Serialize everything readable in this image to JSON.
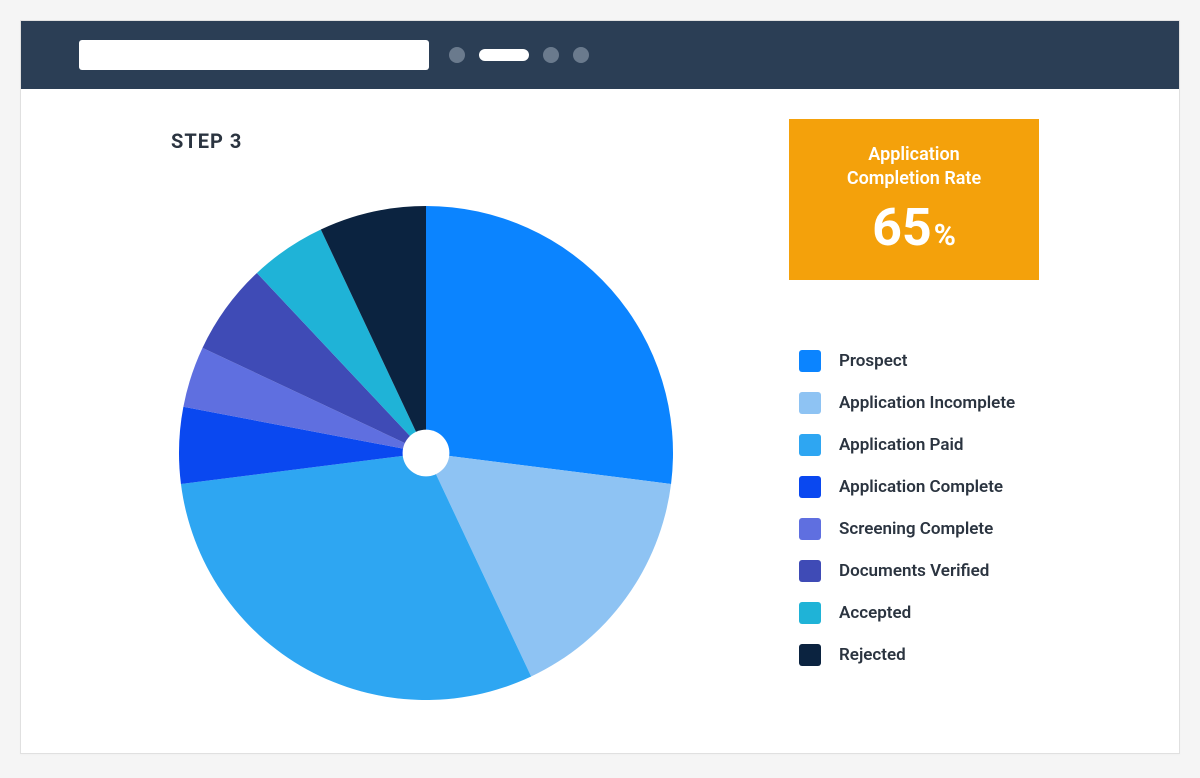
{
  "header": {
    "step_label": "STEP 3"
  },
  "rate_card": {
    "title": "Application\nCompletion Rate",
    "value": "65",
    "suffix": "%"
  },
  "colors": {
    "prospect": "#0b84ff",
    "app_incomplete": "#8ec3f3",
    "app_paid": "#2ea6f2",
    "app_complete": "#0a48f0",
    "screening_complete": "#5f6fe0",
    "documents_verified": "#3f4bb6",
    "accepted": "#1fb3d7",
    "rejected": "#0b2340",
    "card": "#f4a10b",
    "bar": "#2b3e55"
  },
  "chart_data": {
    "type": "pie",
    "title": "",
    "series": [
      {
        "name": "Prospect",
        "value": 27,
        "color_key": "prospect"
      },
      {
        "name": "Application Incomplete",
        "value": 16,
        "color_key": "app_incomplete"
      },
      {
        "name": "Application Paid",
        "value": 30,
        "color_key": "app_paid"
      },
      {
        "name": "Application Complete",
        "value": 5,
        "color_key": "app_complete"
      },
      {
        "name": "Screening Complete",
        "value": 4,
        "color_key": "screening_complete"
      },
      {
        "name": "Documents Verified",
        "value": 6,
        "color_key": "documents_verified"
      },
      {
        "name": "Accepted",
        "value": 5,
        "color_key": "accepted"
      },
      {
        "name": "Rejected",
        "value": 7,
        "color_key": "rejected"
      }
    ]
  }
}
